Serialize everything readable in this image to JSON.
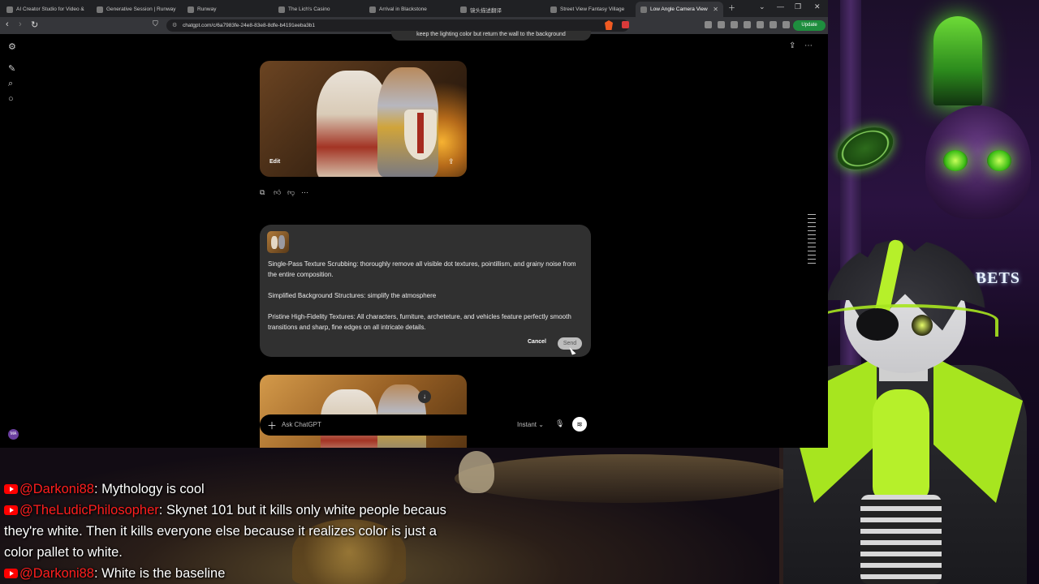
{
  "browser": {
    "tabs": [
      {
        "label": "AI Creator Studio for Video &"
      },
      {
        "label": "Generative Session | Runway"
      },
      {
        "label": "Runway"
      },
      {
        "label": "The Lich's Casino"
      },
      {
        "label": "Arrival in Blackstone"
      },
      {
        "label": "镜头描述翻译"
      },
      {
        "label": "Street View Fantasy Village"
      },
      {
        "label": "Low Angle Camera View"
      }
    ],
    "active_tab_index": 7,
    "url": "chatgpt.com/c/6a7983fe-24e8-83e8-8dfe-b4191eeba3b1",
    "update_label": "Update"
  },
  "chatgpt": {
    "previous_prompt": "keep the lighting color but return the wall to the background",
    "image_edit_label": "Edit",
    "edit_card": {
      "paragraphs": [
        "Single-Pass Texture Scrubbing: thoroughly remove all visible dot textures, pointillism, and grainy noise from the entire composition.",
        "Simplified Background Structures: simplify the atmosphere",
        "Pristine High-Fidelity Textures: All characters, furniture, archeteture, and vehicles feature perfectly smooth transitions and sharp, fine edges on all intricate details."
      ],
      "cancel_label": "Cancel",
      "send_label": "Send"
    },
    "composer": {
      "placeholder": "Ask ChatGPT",
      "mode_label": "Instant"
    },
    "user_initials": "MA"
  },
  "overlay": {
    "sign_text": "S & BETS",
    "chat_messages": [
      {
        "user": "@Darkoni88",
        "text": ": Mythology is cool"
      },
      {
        "user": "@TheLudicPhilosopher",
        "text": ": Skynet 101 but it kills only white people becaus"
      },
      {
        "user": "",
        "text": "they're white. Then it kills everyone else because it realizes color is just a"
      },
      {
        "user": "",
        "text": "color pallet to white."
      },
      {
        "user": "@Darkoni88",
        "text": ": White is the baseline"
      }
    ]
  },
  "colors": {
    "accent_green": "#a7e51f",
    "username_red": "#ff1e1e",
    "chatgpt_card_bg": "#303030"
  }
}
